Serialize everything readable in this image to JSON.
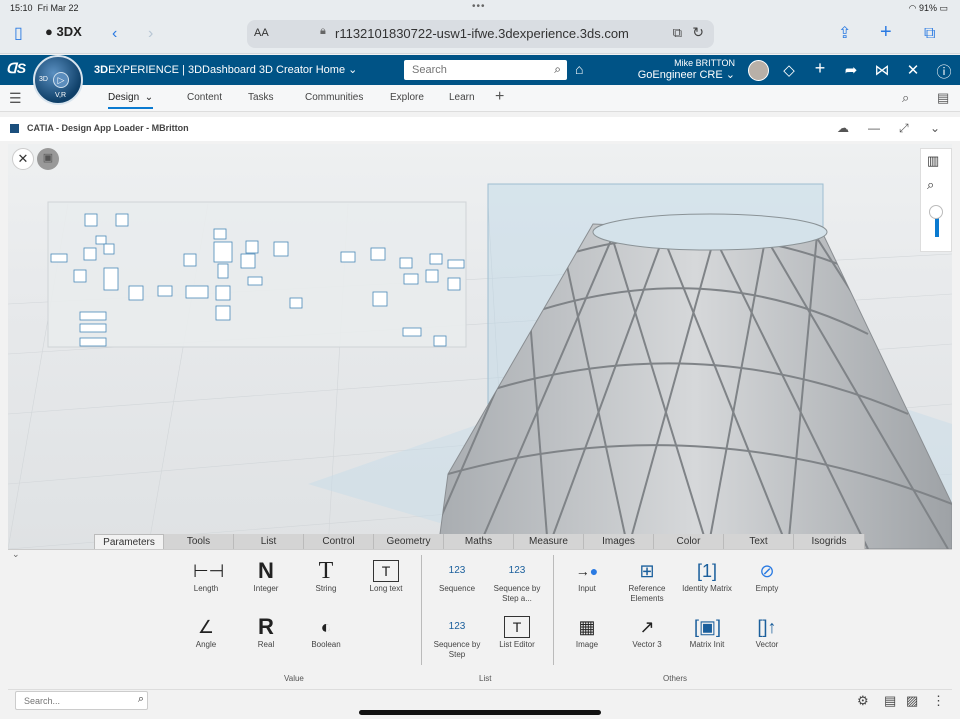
{
  "status": {
    "time": "15:10",
    "date": "Fri Mar 22",
    "battery": "91%"
  },
  "safari": {
    "tab_group": "3DX",
    "aa": "AA",
    "url": "r1132101830722-usw1-ifwe.3dexperience.3ds.com"
  },
  "topbar": {
    "brand_prefix": "3D",
    "brand_bold": "EXPERIENCE",
    "brand_rest": " | 3DDashboard  3D Creator Home",
    "search_placeholder": "Search",
    "user_name": "Mike BRITTON",
    "user_org": "GoEngineer CRE",
    "compass_label": "3D",
    "compass_vr": "V,R"
  },
  "nav": {
    "tabs": [
      {
        "label": "Design"
      },
      {
        "label": "Content"
      },
      {
        "label": "Tasks"
      },
      {
        "label": "Communities"
      },
      {
        "label": "Explore"
      },
      {
        "label": "Learn"
      }
    ]
  },
  "app": {
    "title": "CATIA - Design App Loader - MBritton"
  },
  "action_tabs": [
    "Parameters",
    "Tools",
    "List",
    "Control",
    "Geometry",
    "Maths",
    "Measure",
    "Images",
    "Color",
    "Text",
    "Isogrids"
  ],
  "commands": {
    "length": "Length",
    "integer": "Integer",
    "string": "String",
    "long_text": "Long text",
    "angle": "Angle",
    "real": "Real",
    "boolean": "Boolean",
    "sequence": "Sequence",
    "sequence_step_a": "Sequence by Step a...",
    "sequence_by_step": "Sequence by Step",
    "list_editor": "List Editor",
    "input": "Input",
    "reference_elements": "Reference Elements",
    "identity_matrix": "Identity Matrix",
    "empty": "Empty",
    "image": "Image",
    "vector3": "Vector 3",
    "matrix_init": "Matrix Init",
    "vector": "Vector"
  },
  "groups": {
    "value": "Value",
    "list": "List",
    "others": "Others"
  },
  "bottom": {
    "search_placeholder": "Search..."
  }
}
